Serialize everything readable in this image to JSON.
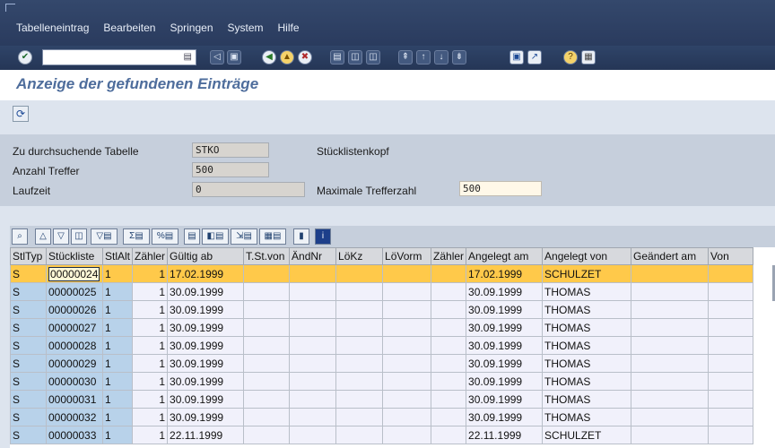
{
  "menu": {
    "items": [
      "Tabelleneintrag",
      "Bearbeiten",
      "Springen",
      "System",
      "Hilfe"
    ]
  },
  "page": {
    "title": "Anzeige der gefundenen Einträge"
  },
  "form": {
    "table_label": "Zu durchsuchende Tabelle",
    "table_value": "STKO",
    "table_desc": "Stücklistenkopf",
    "hits_label": "Anzahl Treffer",
    "hits_value": "500",
    "runtime_label": "Laufzeit",
    "runtime_value": "0",
    "max_label": "Maximale Trefferzahl",
    "max_value": "500"
  },
  "grid": {
    "columns": [
      "StlTyp",
      "Stückliste",
      "StlAlt",
      "Zähler",
      "Gültig ab",
      "T.St.von",
      "ÄndNr",
      "LöKz",
      "LöVorm",
      "Zähler",
      "Angelegt am",
      "Angelegt von",
      "Geändert am",
      "Von"
    ],
    "rows": [
      [
        "S",
        "00000024",
        "1",
        "1",
        "17.02.1999",
        "",
        "",
        "",
        "",
        "",
        "17.02.1999",
        "SCHULZET",
        "",
        ""
      ],
      [
        "S",
        "00000025",
        "1",
        "1",
        "30.09.1999",
        "",
        "",
        "",
        "",
        "",
        "30.09.1999",
        "THOMAS",
        "",
        ""
      ],
      [
        "S",
        "00000026",
        "1",
        "1",
        "30.09.1999",
        "",
        "",
        "",
        "",
        "",
        "30.09.1999",
        "THOMAS",
        "",
        ""
      ],
      [
        "S",
        "00000027",
        "1",
        "1",
        "30.09.1999",
        "",
        "",
        "",
        "",
        "",
        "30.09.1999",
        "THOMAS",
        "",
        ""
      ],
      [
        "S",
        "00000028",
        "1",
        "1",
        "30.09.1999",
        "",
        "",
        "",
        "",
        "",
        "30.09.1999",
        "THOMAS",
        "",
        ""
      ],
      [
        "S",
        "00000029",
        "1",
        "1",
        "30.09.1999",
        "",
        "",
        "",
        "",
        "",
        "30.09.1999",
        "THOMAS",
        "",
        ""
      ],
      [
        "S",
        "00000030",
        "1",
        "1",
        "30.09.1999",
        "",
        "",
        "",
        "",
        "",
        "30.09.1999",
        "THOMAS",
        "",
        ""
      ],
      [
        "S",
        "00000031",
        "1",
        "1",
        "30.09.1999",
        "",
        "",
        "",
        "",
        "",
        "30.09.1999",
        "THOMAS",
        "",
        ""
      ],
      [
        "S",
        "00000032",
        "1",
        "1",
        "30.09.1999",
        "",
        "",
        "",
        "",
        "",
        "30.09.1999",
        "THOMAS",
        "",
        ""
      ],
      [
        "S",
        "00000033",
        "1",
        "1",
        "22.11.1999",
        "",
        "",
        "",
        "",
        "",
        "22.11.1999",
        "SCHULZET",
        "",
        ""
      ]
    ]
  },
  "colors": {
    "menubar": "#2f4468",
    "title_text": "#4e6d9c",
    "selected_row": "#ffc94a",
    "key_column": "#b8d2ea"
  }
}
